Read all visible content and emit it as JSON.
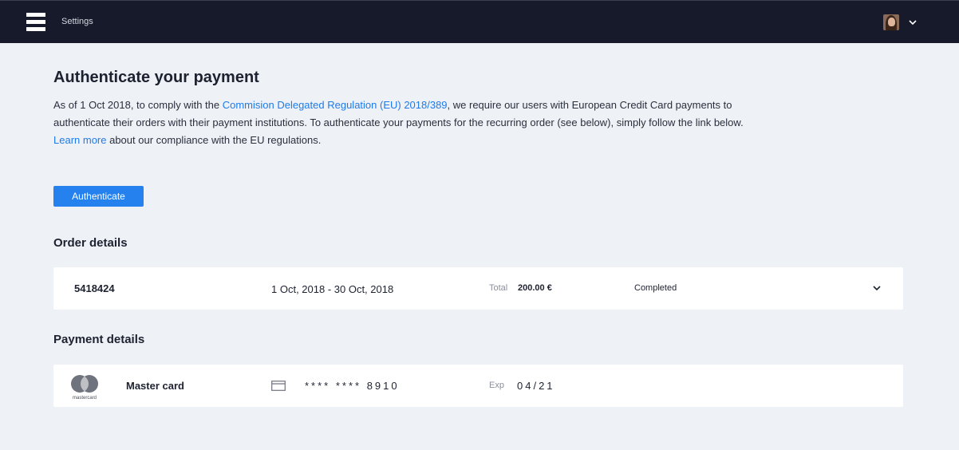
{
  "topbar": {
    "title": "Settings"
  },
  "header": {
    "title": "Authenticate your payment"
  },
  "intro": {
    "part1": "As of 1 Oct 2018, to comply with the ",
    "regulation_link": "Commision Delegated Regulation (EU) 2018/389",
    "part2": ", we require our users with European Credit Card payments to authenticate their orders with their payment institutions. To authenticate your payments for the recurring order (see below), simply follow the link below.",
    "learn_more_link": "Learn more",
    "part3": " about our compliance with the EU regulations."
  },
  "actions": {
    "authenticate_label": "Authenticate"
  },
  "order": {
    "section_title": "Order details",
    "id": "5418424",
    "dates": "1 Oct, 2018 - 30 Oct, 2018",
    "total_label": "Total",
    "total_value": "200.00 €",
    "status": "Completed"
  },
  "payment": {
    "section_title": "Payment details",
    "card_name": "Master card",
    "card_brand": "mastercard",
    "card_number": "**** **** 8910",
    "exp_label": "Exp",
    "exp_value": "04/21"
  },
  "colors": {
    "topbar": "#161a2a",
    "background": "#eef1f5",
    "accent": "#2481ee",
    "link": "#1f7bea"
  },
  "icons": {
    "menu": "hamburger-icon",
    "user_dropdown": "chevron-down-icon",
    "order_expand": "chevron-down-icon",
    "card": "credit-card-icon",
    "brand": "mastercard-logo-icon"
  }
}
